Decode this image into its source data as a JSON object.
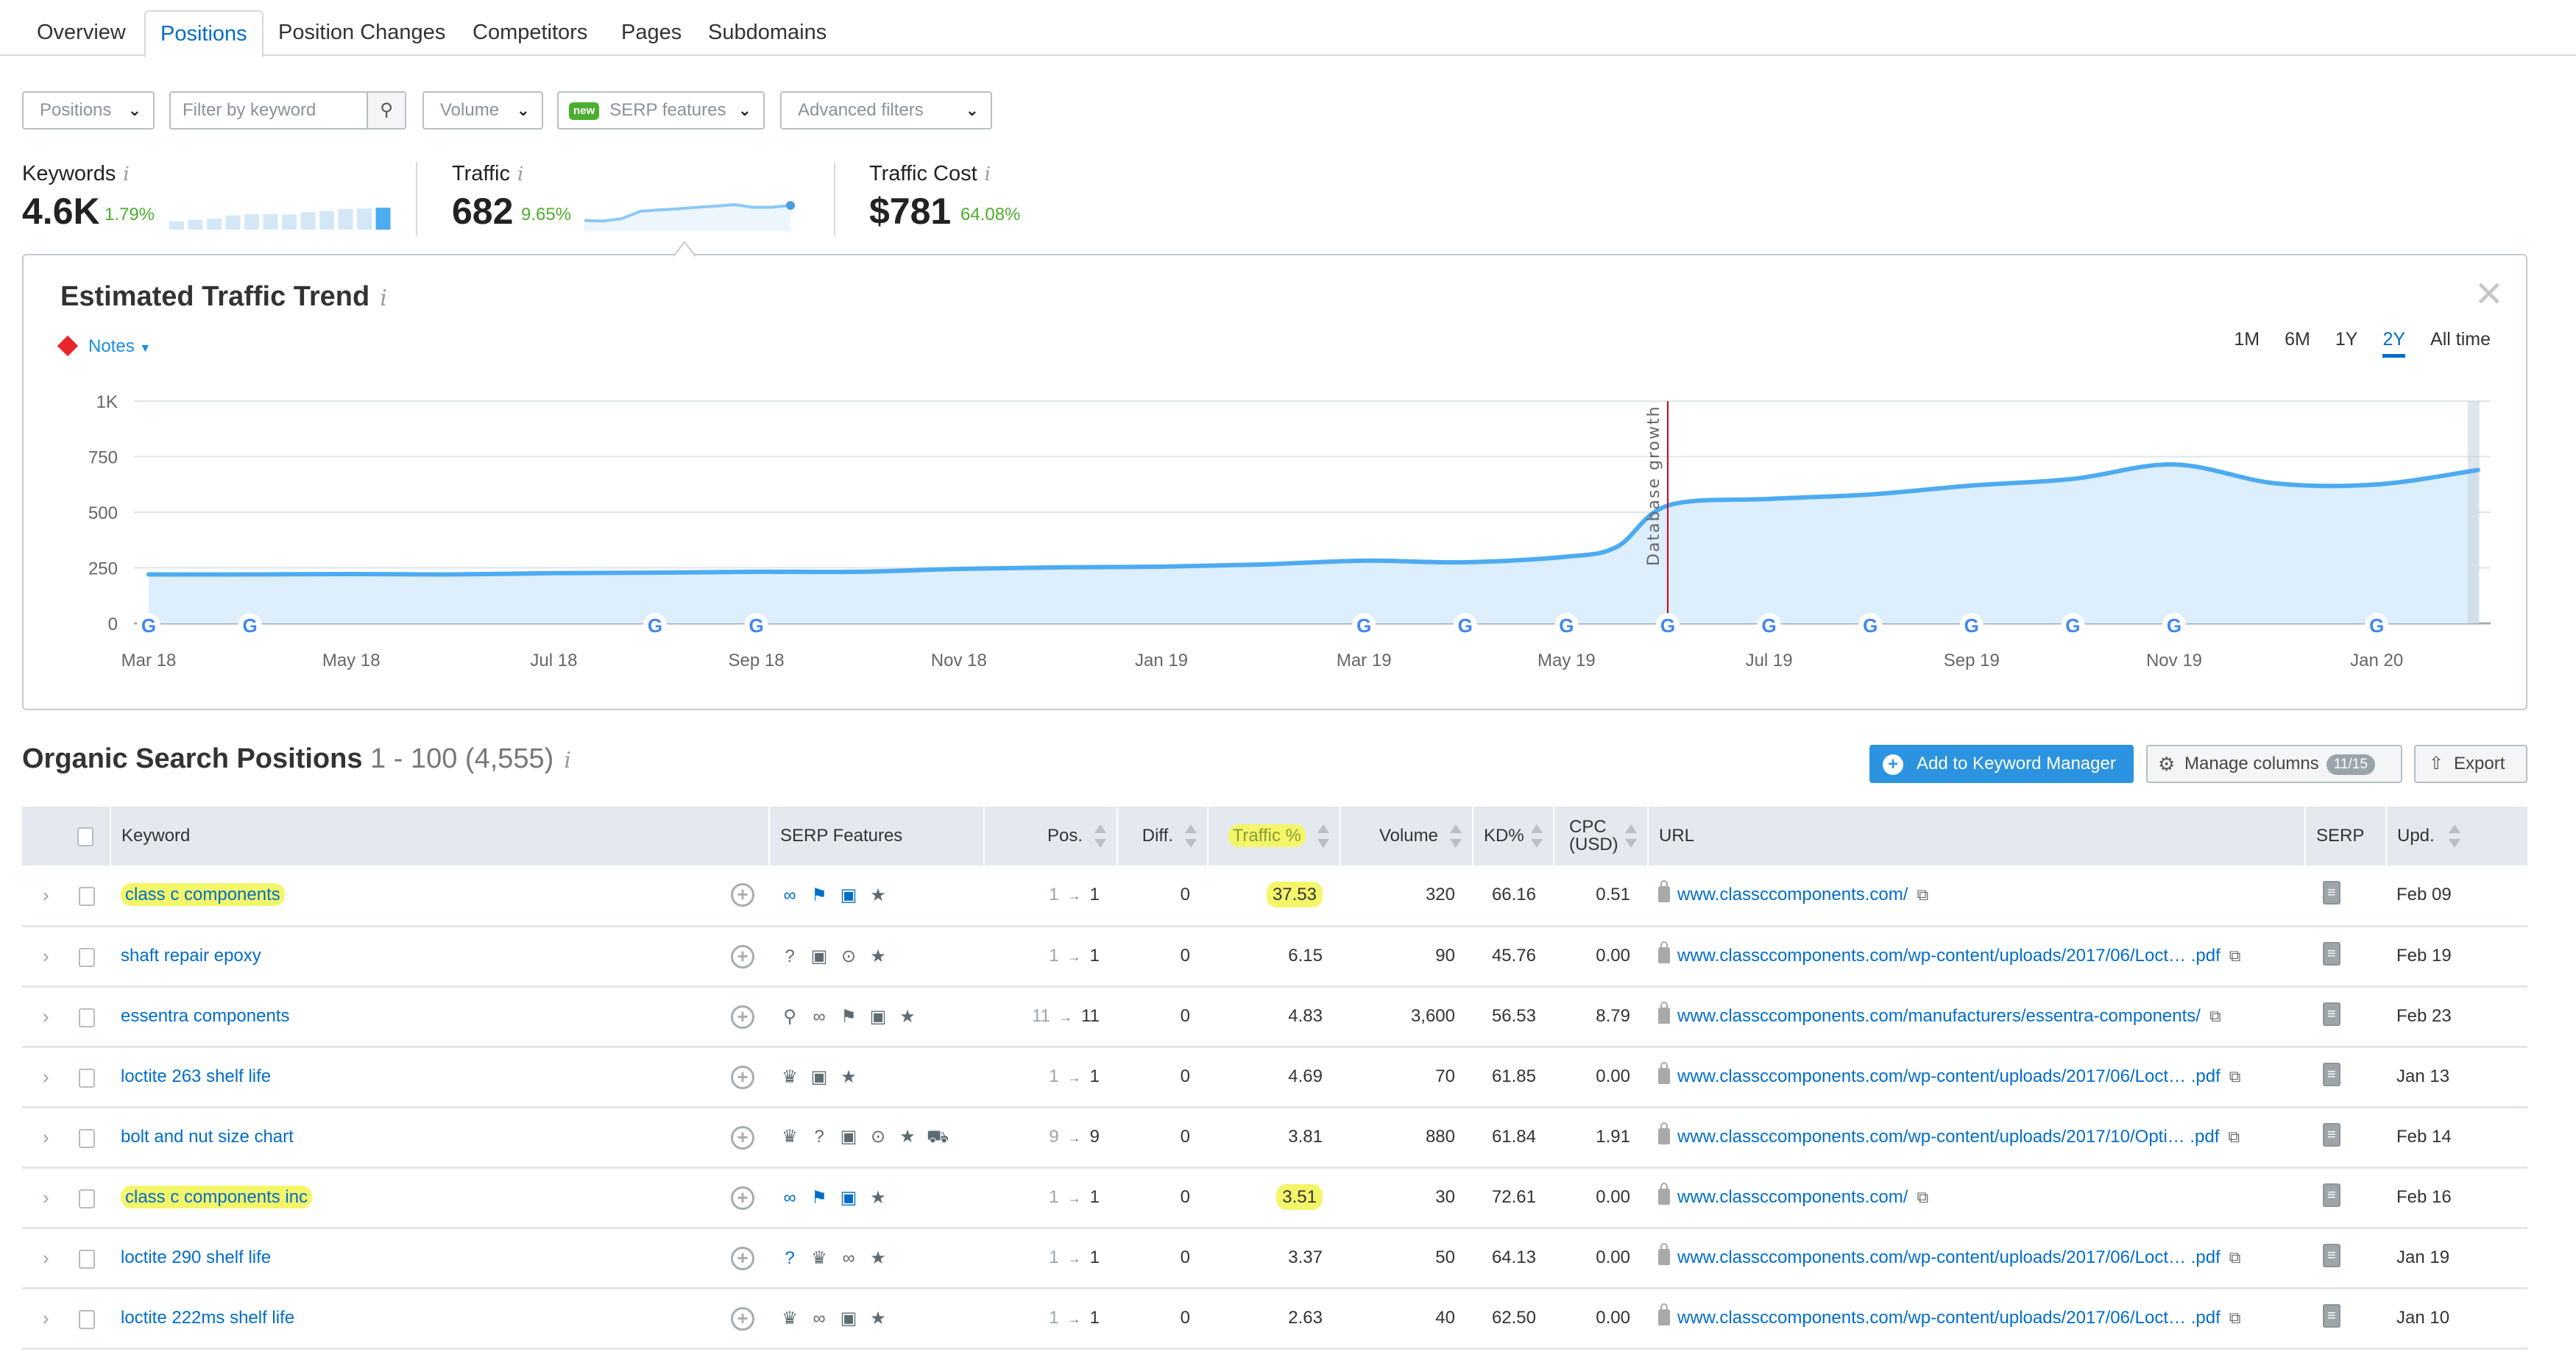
{
  "tabs": [
    {
      "label": "Overview",
      "active": false
    },
    {
      "label": "Positions",
      "active": true
    },
    {
      "label": "Position Changes",
      "active": false
    },
    {
      "label": "Competitors",
      "active": false
    },
    {
      "label": "Pages",
      "active": false
    },
    {
      "label": "Subdomains",
      "active": false
    }
  ],
  "filters": {
    "positions": "Positions",
    "keyword_placeholder": "Filter by keyword",
    "volume": "Volume",
    "serp_badge": "new",
    "serp": "SERP features",
    "advanced": "Advanced filters"
  },
  "metrics": {
    "keywords": {
      "label": "Keywords",
      "value": "4.6K",
      "change": "1.79%",
      "bars": [
        0.35,
        0.42,
        0.47,
        0.6,
        0.66,
        0.66,
        0.64,
        0.74,
        0.79,
        0.87,
        0.9,
        0.93
      ]
    },
    "traffic": {
      "label": "Traffic",
      "value": "682",
      "change": "9.65%",
      "spark": [
        0.4,
        0.38,
        0.47,
        0.75,
        0.8,
        0.84,
        0.9,
        0.94,
        1.0,
        0.9,
        0.9,
        0.97
      ]
    },
    "traffic_cost": {
      "label": "Traffic Cost",
      "value": "$781",
      "change": "64.08%"
    }
  },
  "trend": {
    "title": "Estimated Traffic Trend",
    "notes_label": "Notes",
    "ranges": [
      {
        "label": "1M",
        "active": false
      },
      {
        "label": "6M",
        "active": false
      },
      {
        "label": "1Y",
        "active": false
      },
      {
        "label": "2Y",
        "active": true
      },
      {
        "label": "All time",
        "active": false
      }
    ]
  },
  "chart_data": {
    "type": "area",
    "title": "Estimated Traffic Trend",
    "xlabel": "",
    "ylabel": "",
    "ylim": [
      0,
      1000
    ],
    "yticks": [
      "0",
      "250",
      "500",
      "750",
      "1K"
    ],
    "ytick_values": [
      0,
      250,
      500,
      750,
      1000
    ],
    "xticks": [
      "Mar 18",
      "May 18",
      "Jul 18",
      "Sep 18",
      "Nov 18",
      "Jan 19",
      "Mar 19",
      "May 19",
      "Jul 19",
      "Sep 19",
      "Nov 19",
      "Jan 20"
    ],
    "xtick_month_index": [
      0,
      2,
      4,
      6,
      8,
      10,
      12,
      14,
      16,
      18,
      20,
      22
    ],
    "x_months": [
      0,
      1,
      2,
      3,
      4,
      5,
      6,
      7,
      8,
      9,
      10,
      11,
      12,
      13,
      14,
      14.5,
      15,
      16,
      17,
      18,
      19,
      20,
      21,
      22,
      23
    ],
    "series": [
      {
        "name": "Traffic",
        "values": [
          220,
          220,
          222,
          220,
          226,
          228,
          232,
          232,
          245,
          252,
          255,
          265,
          282,
          275,
          300,
          345,
          530,
          560,
          580,
          620,
          650,
          715,
          630,
          625,
          690
        ]
      }
    ],
    "grid": true,
    "annotations": [
      {
        "label": "Database growth",
        "x_month": 15
      }
    ],
    "google_update_months": [
      0,
      1,
      5,
      6,
      12,
      13,
      14,
      15,
      16,
      17,
      18,
      19,
      20,
      22
    ],
    "series_color": "#4dabf0"
  },
  "positions": {
    "title": "Organic Search Positions",
    "range": "1 - 100 (4,555)",
    "add_button": "Add to Keyword Manager",
    "manage_columns": "Manage columns",
    "columns_count": "11/15",
    "export": "Export",
    "headers": {
      "keyword": "Keyword",
      "serp_features": "SERP Features",
      "pos": "Pos.",
      "diff": "Diff.",
      "traffic": "Traffic %",
      "volume": "Volume",
      "kd": "KD%",
      "cpc": "CPC (USD)",
      "url": "URL",
      "serp": "SERP",
      "upd": "Upd."
    },
    "rows": [
      {
        "keyword": "class c components",
        "highlight": true,
        "features": [
          "link-icon",
          "knowledge-panel-icon",
          "image-icon",
          "star-icon"
        ],
        "features_blue": true,
        "pos_from": "1",
        "pos_to": "1",
        "diff": "0",
        "traffic": "37.53",
        "volume": "320",
        "kd": "66.16",
        "cpc": "0.51",
        "url": "www.classccomponents.com/",
        "upd": "Feb 09"
      },
      {
        "keyword": "shaft repair epoxy",
        "highlight": false,
        "features": [
          "faq-icon",
          "image-icon",
          "video-icon",
          "star-icon"
        ],
        "features_blue": false,
        "pos_from": "1",
        "pos_to": "1",
        "diff": "0",
        "traffic": "6.15",
        "volume": "90",
        "kd": "45.76",
        "cpc": "0.00",
        "url": "www.classccomponents.com/wp-content/uploads/2017/06/Loct… .pdf",
        "upd": "Feb 19"
      },
      {
        "keyword": "essentra components",
        "highlight": false,
        "features": [
          "local-pack-icon",
          "link-icon",
          "knowledge-panel-icon",
          "image-icon",
          "star-icon"
        ],
        "features_blue": false,
        "pos_from": "11",
        "pos_to": "11",
        "diff": "0",
        "traffic": "4.83",
        "volume": "3,600",
        "kd": "56.53",
        "cpc": "8.79",
        "url": "www.classccomponents.com/manufacturers/essentra-components/",
        "upd": "Feb 23"
      },
      {
        "keyword": "loctite 263 shelf life",
        "highlight": false,
        "features": [
          "crown-icon",
          "image-icon",
          "star-icon"
        ],
        "features_blue": false,
        "pos_from": "1",
        "pos_to": "1",
        "diff": "0",
        "traffic": "4.69",
        "volume": "70",
        "kd": "61.85",
        "cpc": "0.00",
        "url": "www.classccomponents.com/wp-content/uploads/2017/06/Loct… .pdf",
        "upd": "Jan 13"
      },
      {
        "keyword": "bolt and nut size chart",
        "highlight": false,
        "features": [
          "crown-icon",
          "faq-icon",
          "image-icon",
          "video-icon",
          "star-icon",
          "cart-icon"
        ],
        "features_blue": false,
        "pos_from": "9",
        "pos_to": "9",
        "diff": "0",
        "traffic": "3.81",
        "volume": "880",
        "kd": "61.84",
        "cpc": "1.91",
        "url": "www.classccomponents.com/wp-content/uploads/2017/10/Opti… .pdf",
        "upd": "Feb 14"
      },
      {
        "keyword": "class c components inc",
        "highlight": true,
        "features": [
          "link-icon",
          "knowledge-panel-icon",
          "image-icon",
          "star-icon"
        ],
        "features_blue": true,
        "pos_from": "1",
        "pos_to": "1",
        "diff": "0",
        "traffic": "3.51",
        "volume": "30",
        "kd": "72.61",
        "cpc": "0.00",
        "url": "www.classccomponents.com/",
        "upd": "Feb 16"
      },
      {
        "keyword": "loctite 290 shelf life",
        "highlight": false,
        "features": [
          "faq-icon",
          "crown-icon",
          "link-icon",
          "star-icon"
        ],
        "features_blue": false,
        "pos_from": "1",
        "pos_to": "1",
        "diff": "0",
        "traffic": "3.37",
        "volume": "50",
        "kd": "64.13",
        "cpc": "0.00",
        "url": "www.classccomponents.com/wp-content/uploads/2017/06/Loct… .pdf",
        "upd": "Jan 19"
      },
      {
        "keyword": "loctite 222ms shelf life",
        "highlight": false,
        "features": [
          "crown-icon",
          "link-icon",
          "image-icon",
          "star-icon"
        ],
        "features_blue": false,
        "pos_from": "1",
        "pos_to": "1",
        "diff": "0",
        "traffic": "2.63",
        "volume": "40",
        "kd": "62.50",
        "cpc": "0.00",
        "url": "www.classccomponents.com/wp-content/uploads/2017/06/Loct… .pdf",
        "upd": "Jan 10"
      }
    ]
  }
}
